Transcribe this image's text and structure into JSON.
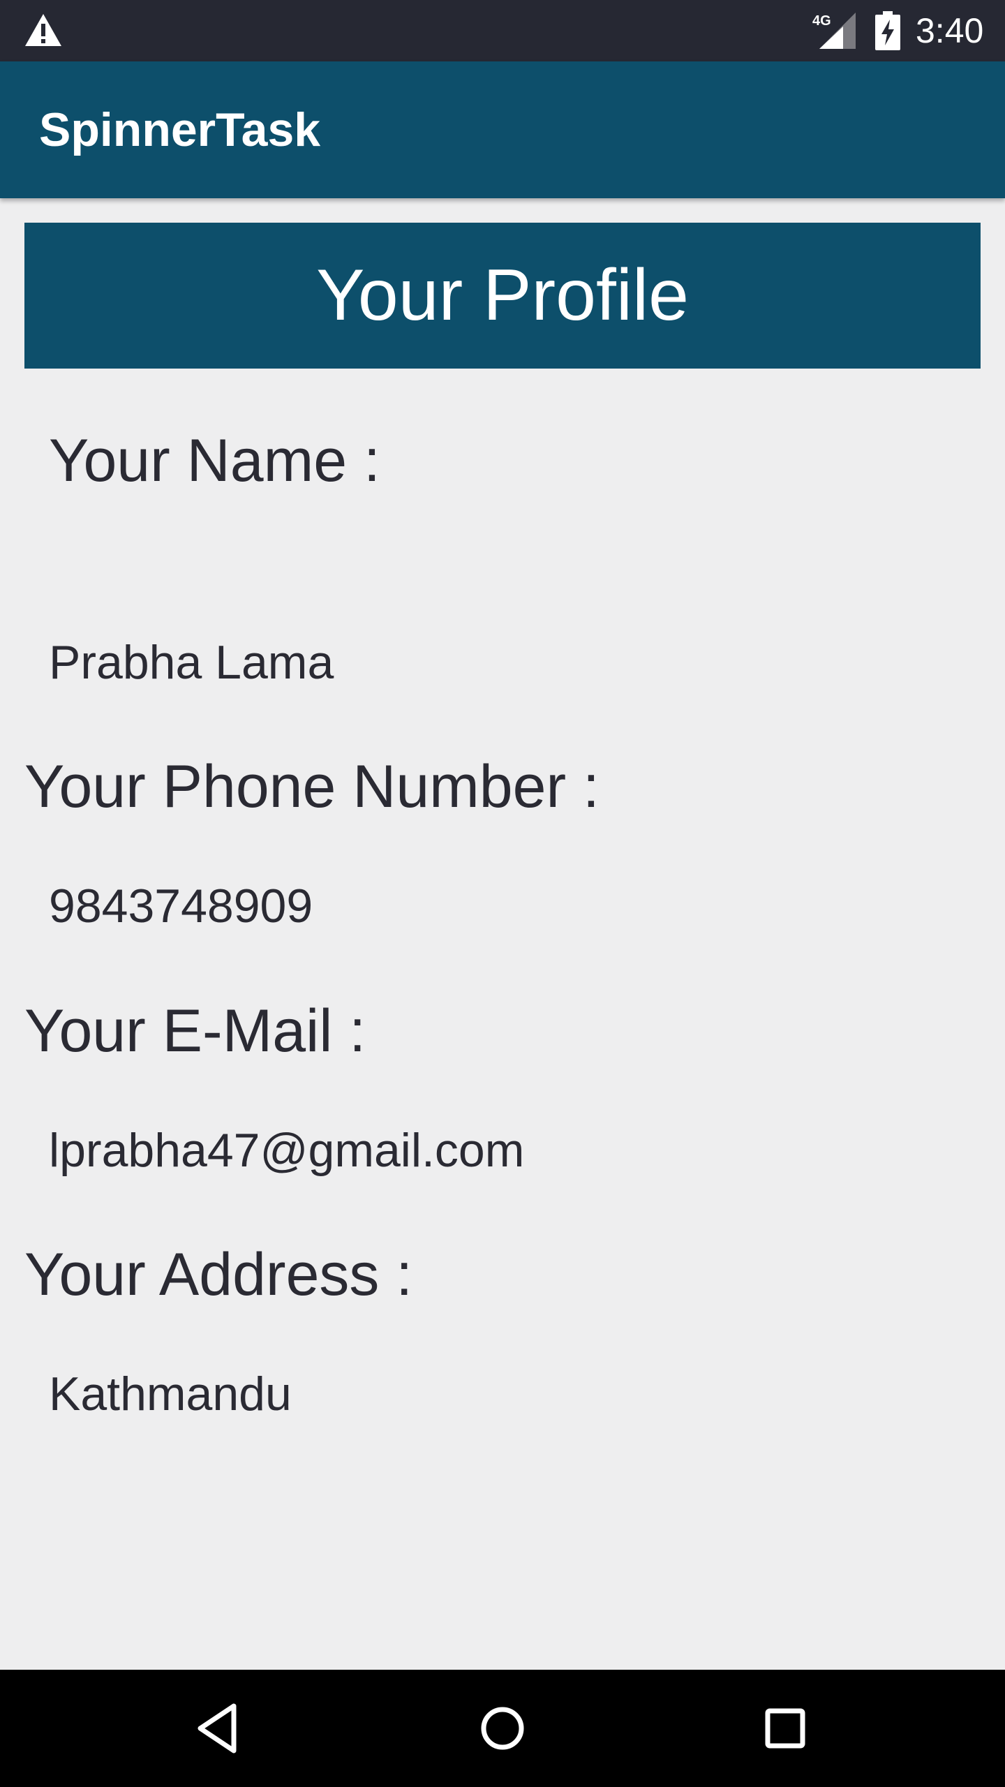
{
  "status_bar": {
    "time": "3:40",
    "network": "4G",
    "icons": [
      "warning-icon",
      "signal-icon",
      "battery-charging-icon"
    ]
  },
  "app_bar": {
    "title": "SpinnerTask"
  },
  "profile": {
    "header": "Your Profile",
    "fields": [
      {
        "label": "Your Name :",
        "value": "Prabha Lama"
      },
      {
        "label": "Your Phone Number :",
        "value": "9843748909"
      },
      {
        "label": "Your E-Mail :",
        "value": "lprabha47@gmail.com"
      },
      {
        "label": "Your Address :",
        "value": "Kathmandu"
      }
    ]
  },
  "nav_bar": {
    "icons": [
      "back-icon",
      "home-icon",
      "recents-icon"
    ]
  },
  "colors": {
    "primary": "#0d4f6b",
    "status_bar": "#262833",
    "background": "#eeeeef",
    "text": "#2a2a33"
  }
}
